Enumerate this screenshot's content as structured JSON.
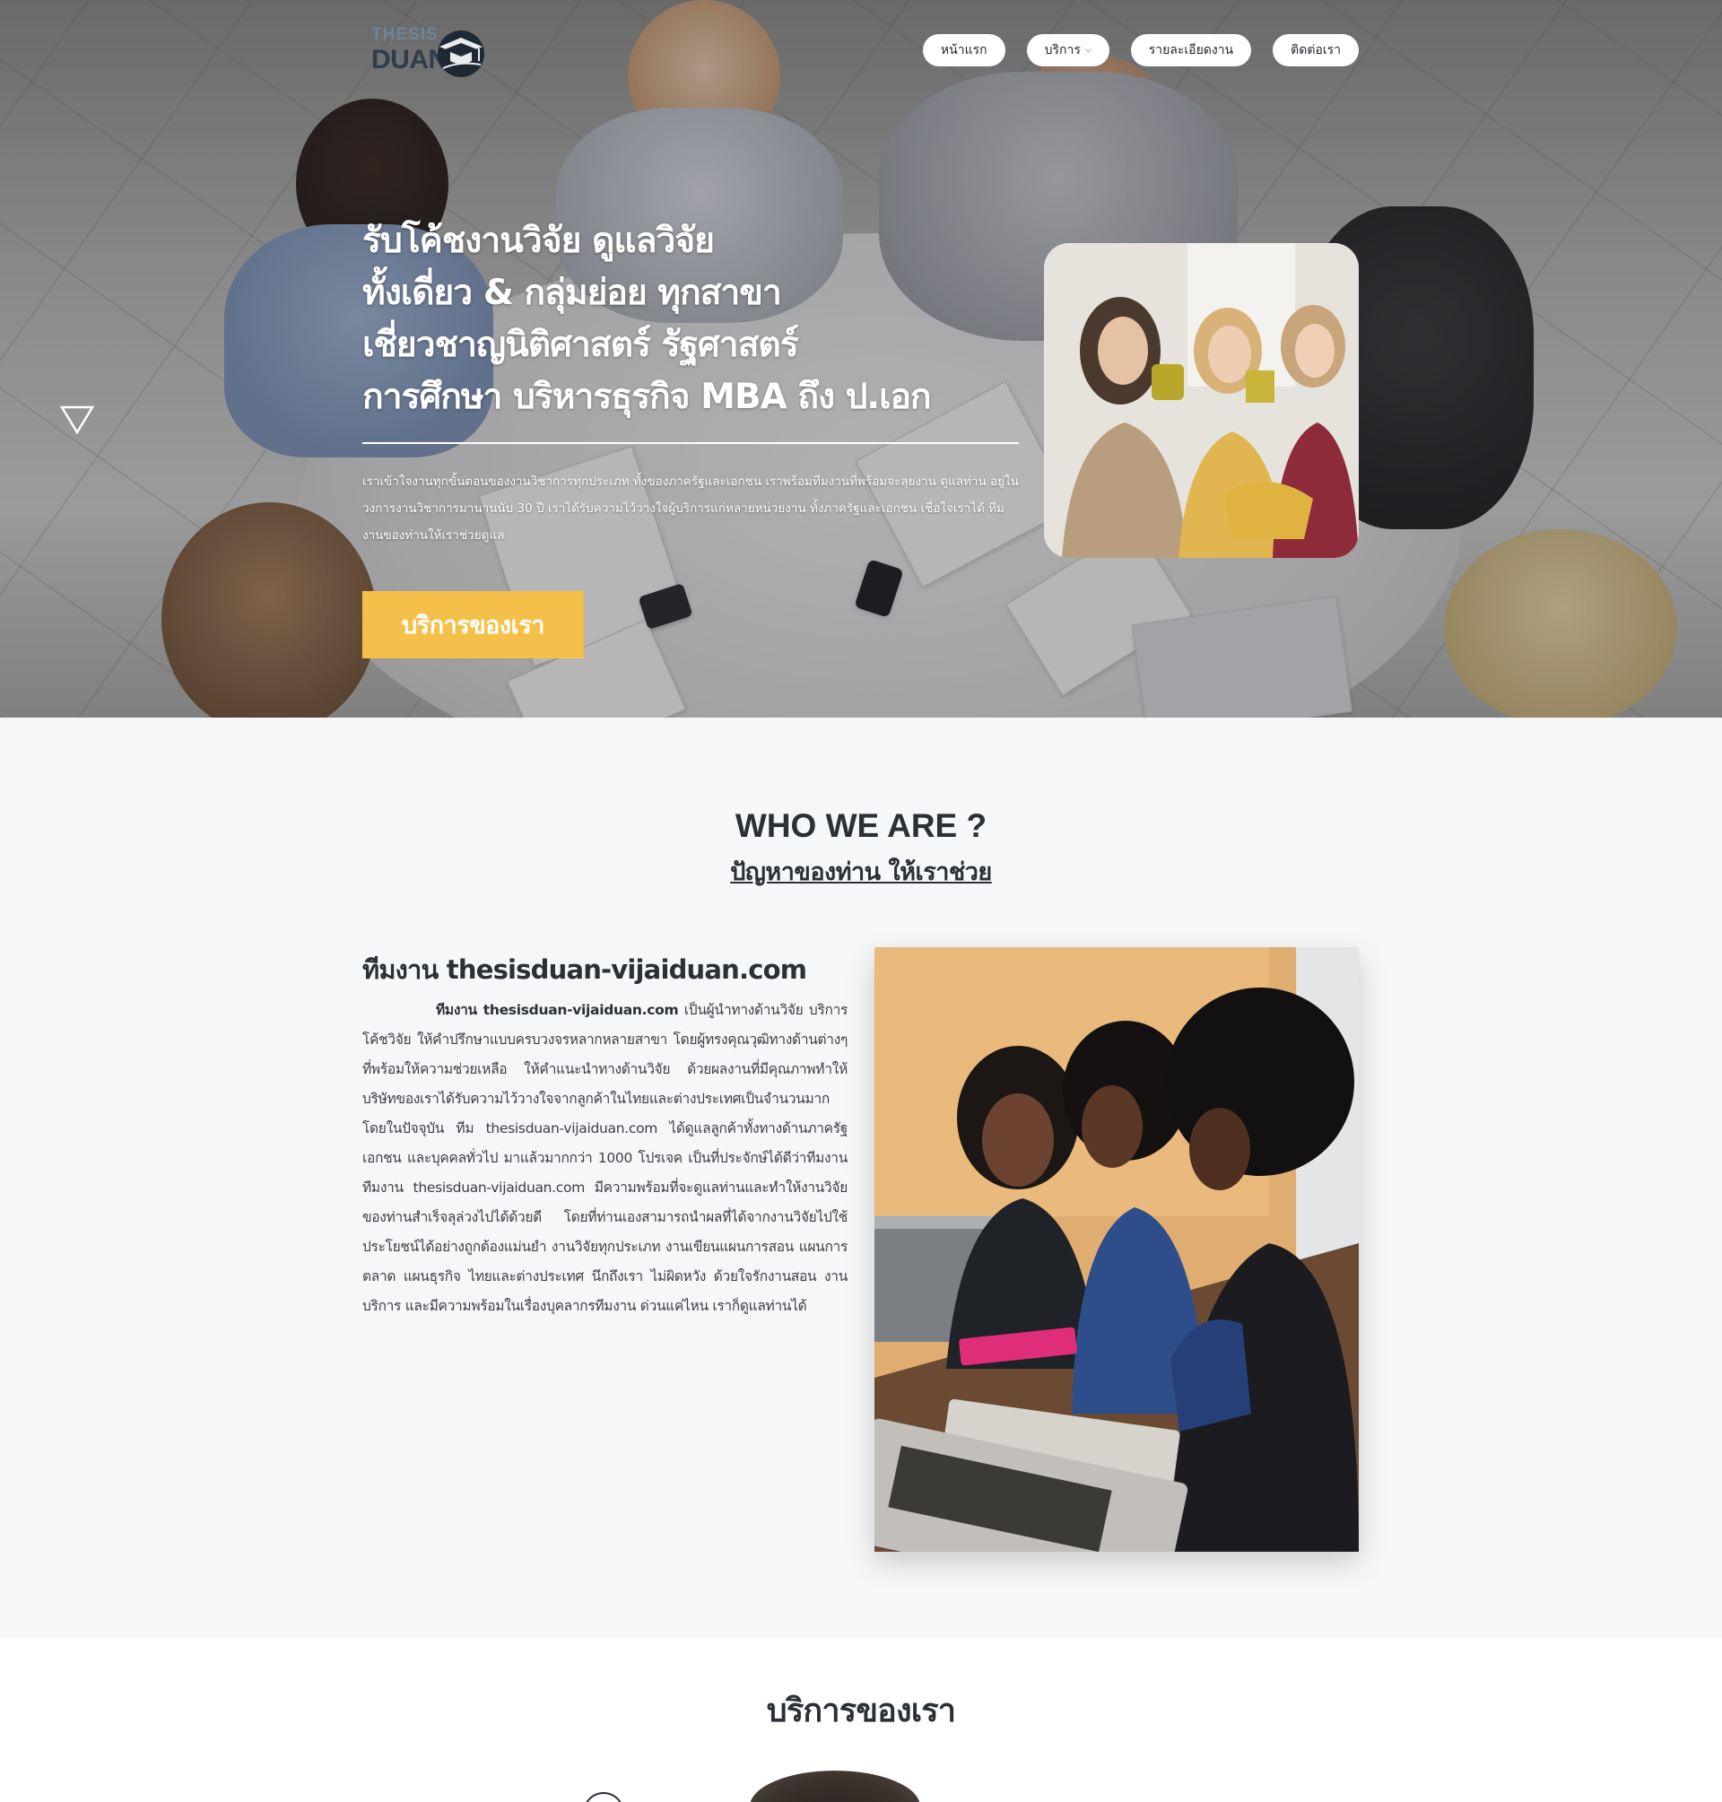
{
  "header": {
    "logo": {
      "line1": "THESIS",
      "line2": "DUAN"
    },
    "nav": [
      {
        "label": "หน้าแรก"
      },
      {
        "label": "บริการ",
        "has_dropdown": true
      },
      {
        "label": "รายละเอียดงาน"
      },
      {
        "label": "ติดต่อเรา"
      }
    ]
  },
  "hero": {
    "title_lines": [
      "รับโค้ชงานวิจัย ดูแลวิจัย",
      "ทั้งเดี่ยว & กลุ่มย่อย ทุกสาขา",
      "เชี่ยวชาญนิติศาสตร์ รัฐศาสตร์",
      "การศึกษา บริหารธุรกิจ MBA ถึง ป.เอก"
    ],
    "description": "เราเข้าใจงานทุกขั้นตอนของงานวิชาการทุกประเภท ทั้งของภาครัฐและเอกชน เราพร้อมทีมงานที่พร้อมจะลุยงาน ดูแลท่าน อยู่ในวงการงานวิชาการมานานนับ 30 ปี เราได้รับความไว้วางใจผู้บริการแก่หลายหน่วยงาน ทั้งภาครัฐและเอกชน เชื่อใจเราได้ ทีมงานของท่านให้เราช่วยดูแล",
    "cta_label": "บริการของเรา"
  },
  "who": {
    "title": "WHO WE ARE ?",
    "subtitle": "ปัญหาของท่าน ให้เราช่วย",
    "team_title": "ทีมงาน thesisduan-vijaiduan.com",
    "team_lead": "ทีมงาน thesisduan-vijaiduan.com",
    "team_body": " เป็นผู้นำทางด้านวิจัย บริการโค้ชวิจัย ให้คำปรึกษาแบบครบวงจรหลากหลายสาขา โดยผู้ทรงคุณวุฒิทางด้านต่างๆ ที่พร้อมให้ความช่วยเหลือ ให้คำแนะนำทางด้านวิจัย ด้วยผลงานที่มีคุณภาพทำให้บริษัทของเราได้รับความไว้วางใจจากลูกค้าในไทยและต่างประเทศเป็นจำนวนมาก โดยในปัจจุบัน ทีม thesisduan-vijaiduan.com ได้ดูแลลูกค้าทั้งทางด้านภาครัฐ เอกชน และบุคคลทั่วไป มาแล้วมากกว่า 1000 โปรเจค เป็นที่ประจักษ์ได้ดีว่าทีมงาน ทีมงาน thesisduan-vijaiduan.com มีความพร้อมที่จะดูแลท่านและทำให้งานวิจัยของท่านสำเร็จลุล่วงไปได้ด้วยดี โดยที่ท่านเองสามารถนำผลที่ได้จากงานวิจัยไปใช้ประโยชน์ได้อย่างถูกต้องแม่นยำ งานวิจัยทุกประเภท งานเขียนแผนการสอน แผนการตลาด แผนธุรกิจ ไทยและต่างประเทศ นึกถึงเรา ไม่ผิดหวัง ด้วยใจรักงานสอน งานบริการ และมีความพร้อมในเรื่องบุคลากรทีมงาน ด่วนแค่ไหน เราก็ดูแลท่านได้"
  },
  "services": {
    "title": "บริการของเรา"
  },
  "colors": {
    "accent": "#f5c04a",
    "heading": "#2b3036",
    "section_bg": "#f6f7f9"
  }
}
